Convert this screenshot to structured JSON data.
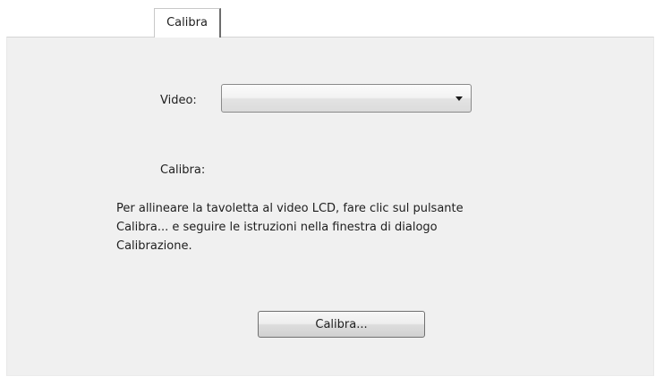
{
  "tabs": [
    {
      "label": "Calibra",
      "selected": true
    }
  ],
  "video": {
    "label": "Video:",
    "selected_value": "",
    "icon": "chevron-down-icon"
  },
  "calibra_section": {
    "label": "Calibra:",
    "description": "Per allineare la tavoletta al video LCD, fare clic sul pulsante\nCalibra... e seguire le istruzioni nella finestra di dialogo\nCalibrazione."
  },
  "calibrate_button": {
    "label": "Calibra..."
  },
  "colors": {
    "panel_background": "#f0f0f0",
    "page_background": "#ffffff",
    "border": "#c8c8c8",
    "text": "#1e1e1e"
  }
}
